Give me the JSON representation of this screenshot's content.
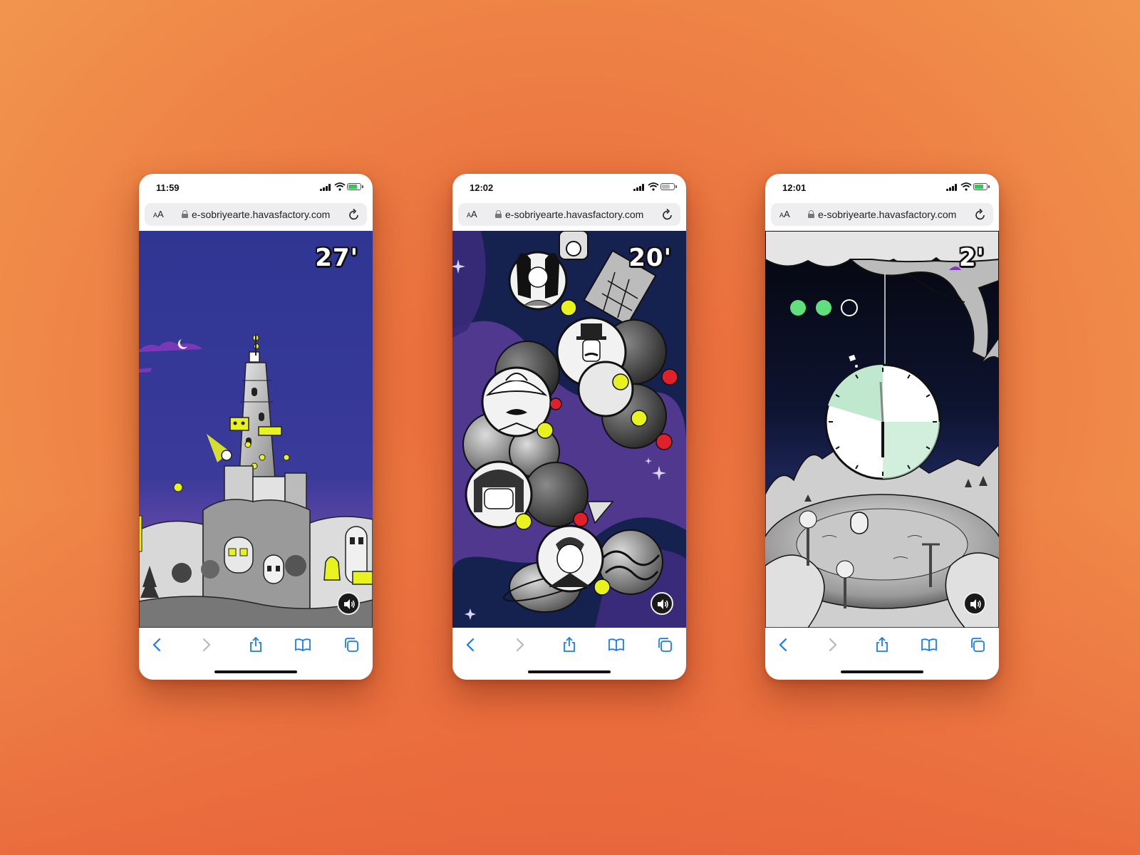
{
  "phones": [
    {
      "time": "11:59",
      "url": "e-sobriyearte.havasfactory.com",
      "aa": "AA",
      "timer": "27'",
      "scene": "tower-city"
    },
    {
      "time": "12:02",
      "url": "e-sobriyearte.havasfactory.com",
      "aa": "AA",
      "timer": "20'",
      "scene": "space-video-call"
    },
    {
      "time": "12:01",
      "url": "e-sobriyearte.havasfactory.com",
      "aa": "AA",
      "timer": "2'",
      "scene": "pendulum-clock"
    }
  ],
  "colors": {
    "sky_blue": "#2f3592",
    "space_navy": "#15214f",
    "nebula_purple": "#5a3c9a",
    "accent_yellow": "#e7f21f",
    "camera_off_red": "#e0202a",
    "clock_green": "#bfe8cf",
    "progress_green": "#5fe07c",
    "ios_blue": "#1a7cf5"
  },
  "icons": [
    "lock-icon",
    "reload-icon",
    "signal-icon",
    "wifi-icon",
    "battery-icon",
    "sound-icon",
    "back-icon",
    "forward-icon",
    "share-icon",
    "bookmarks-icon",
    "tabs-icon"
  ],
  "camera_badges": {
    "on": "ON",
    "off": "OFF"
  },
  "progress": {
    "filled": 2,
    "total": 3
  }
}
